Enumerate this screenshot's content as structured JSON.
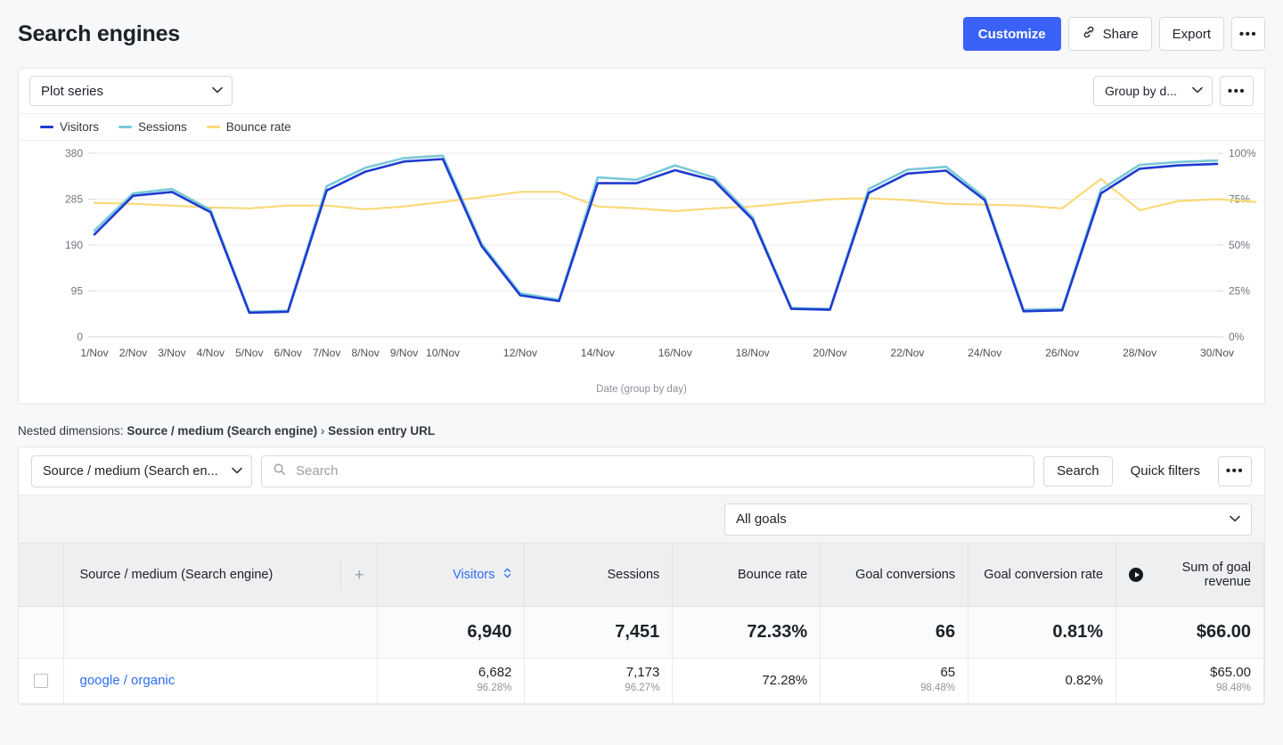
{
  "header": {
    "title": "Search engines",
    "customize_label": "Customize",
    "share_label": "Share",
    "export_label": "Export",
    "more_label": "•••",
    "link_icon": "link-icon"
  },
  "chart_toolbar": {
    "plot_series_label": "Plot series",
    "group_by_label": "Group by d...",
    "more_label": "•••",
    "caret": "⌄"
  },
  "chart_data": {
    "type": "line",
    "title": "",
    "xlabel": "Date (group by day)",
    "ylabel": "",
    "grid": true,
    "legend_position": "top-left",
    "x": [
      "1/Nov",
      "2/Nov",
      "3/Nov",
      "4/Nov",
      "5/Nov",
      "6/Nov",
      "7/Nov",
      "8/Nov",
      "9/Nov",
      "10/Nov",
      "11/Nov",
      "12/Nov",
      "13/Nov",
      "14/Nov",
      "15/Nov",
      "16/Nov",
      "17/Nov",
      "18/Nov",
      "19/Nov",
      "20/Nov",
      "21/Nov",
      "22/Nov",
      "23/Nov",
      "24/Nov",
      "25/Nov",
      "26/Nov",
      "27/Nov",
      "28/Nov",
      "29/Nov",
      "30/Nov"
    ],
    "xticks": [
      "1/Nov",
      "2/Nov",
      "3/Nov",
      "4/Nov",
      "5/Nov",
      "6/Nov",
      "7/Nov",
      "8/Nov",
      "9/Nov",
      "10/Nov",
      "12/Nov",
      "14/Nov",
      "16/Nov",
      "18/Nov",
      "20/Nov",
      "22/Nov",
      "24/Nov",
      "26/Nov",
      "28/Nov",
      "30/Nov"
    ],
    "yticks_left": [
      "0",
      "95",
      "190",
      "285",
      "380"
    ],
    "yticks_right": [
      "0%",
      "25%",
      "50%",
      "75%",
      "100%"
    ],
    "ylim": [
      0,
      380
    ],
    "ylim_right": [
      0,
      100
    ],
    "series": [
      {
        "name": "Visitors",
        "color": "#1f3bd0",
        "axis": "left",
        "values": [
          212,
          292,
          300,
          258,
          50,
          52,
          303,
          342,
          363,
          368,
          188,
          86,
          74,
          318,
          318,
          345,
          324,
          243,
          58,
          56,
          298,
          338,
          344,
          283,
          53,
          55,
          297,
          348,
          355,
          358
        ]
      },
      {
        "name": "Sessions",
        "color": "#79c9d8",
        "axis": "left",
        "values": [
          220,
          297,
          306,
          263,
          52,
          54,
          312,
          350,
          370,
          375,
          193,
          90,
          77,
          330,
          325,
          355,
          330,
          248,
          60,
          58,
          306,
          346,
          352,
          288,
          56,
          58,
          305,
          356,
          362,
          365
        ]
      },
      {
        "name": "Bounce rate",
        "color": "#fad978",
        "axis": "right",
        "values": [
          73,
          72.5,
          71.5,
          70.5,
          70,
          71.5,
          71.5,
          69.5,
          71,
          73.5,
          76,
          79,
          79,
          71,
          70,
          68.5,
          70,
          71,
          73,
          75,
          75.5,
          74.5,
          72.5,
          72,
          71.5,
          70,
          86,
          69,
          74,
          75,
          73.5
        ]
      }
    ]
  },
  "nested": {
    "prefix": "Nested dimensions: ",
    "dim1": "Source / medium (Search engine)",
    "separator": " › ",
    "dim2": "Session entry URL"
  },
  "table_toolbar": {
    "dimension_value": "Source / medium (Search en...",
    "search_placeholder": "Search",
    "search_value": "",
    "search_button": "Search",
    "quick_filters": "Quick filters",
    "more_label": "•••",
    "goals_value": "All goals"
  },
  "table": {
    "columns": [
      "Source / medium (Search engine)",
      "Visitors",
      "Sessions",
      "Bounce rate",
      "Goal conversions",
      "Goal conversion rate",
      "Sum of goal revenue"
    ],
    "sorted_column": "Visitors",
    "add_column_icon": "plus-icon",
    "revenue_icon": "play-circle-icon",
    "totals": {
      "visitors": "6,940",
      "sessions": "7,451",
      "bounce_rate": "72.33%",
      "goal_conversions": "66",
      "goal_conversion_rate": "0.81%",
      "goal_revenue": "$66.00"
    },
    "rows": [
      {
        "label": "google / organic",
        "visitors": "6,682",
        "visitors_pct": "96.28%",
        "sessions": "7,173",
        "sessions_pct": "96.27%",
        "bounce_rate": "72.28%",
        "goal_conversions": "65",
        "goal_conversions_pct": "98.48%",
        "goal_conversion_rate": "0.82%",
        "goal_revenue": "$65.00",
        "goal_revenue_pct": "98.48%"
      }
    ]
  }
}
